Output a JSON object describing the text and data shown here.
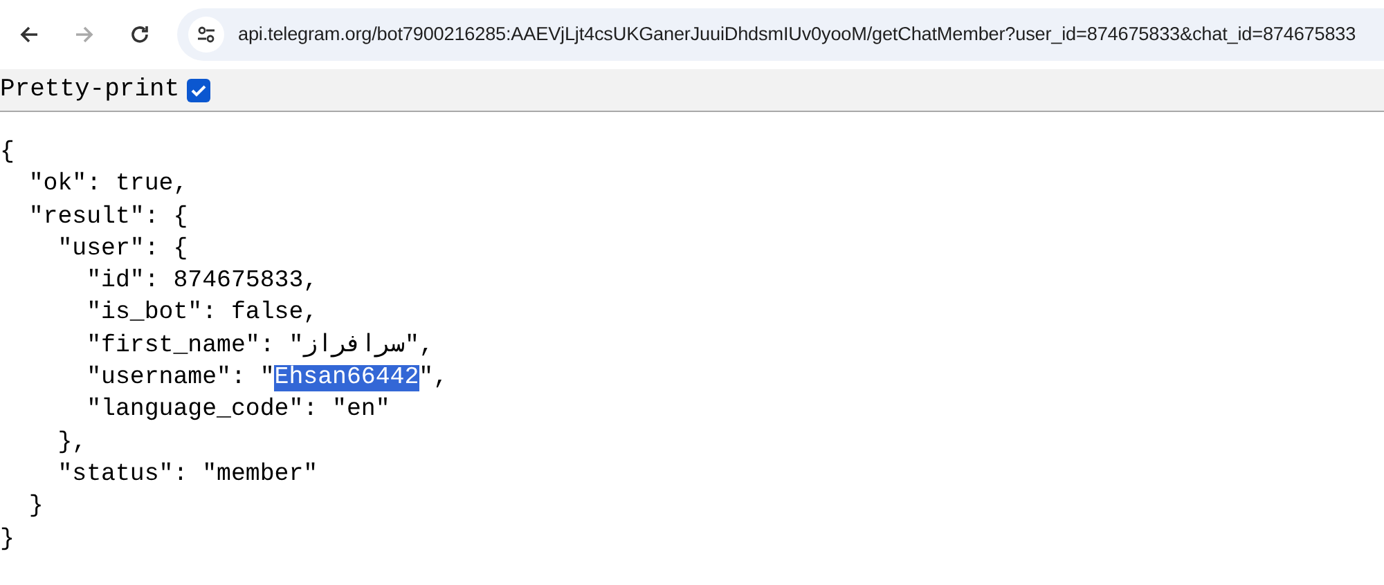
{
  "toolbar": {
    "url": "api.telegram.org/bot7900216285:AAEVjLjt4csUKGanerJuuiDhdsmIUv0yooM/getChatMember?user_id=874675833&chat_id=874675833",
    "forward_disabled": true
  },
  "pretty_print": {
    "label": "Pretty-print",
    "checked": true
  },
  "json_lines": [
    [
      {
        "text": "{",
        "selected": false
      }
    ],
    [
      {
        "text": "  \"ok\": true,",
        "selected": false
      }
    ],
    [
      {
        "text": "  \"result\": {",
        "selected": false
      }
    ],
    [
      {
        "text": "    \"user\": {",
        "selected": false
      }
    ],
    [
      {
        "text": "      \"id\": 874675833,",
        "selected": false
      }
    ],
    [
      {
        "text": "      \"is_bot\": false,",
        "selected": false
      }
    ],
    [
      {
        "text": "      \"first_name\": \"سرافراز\",",
        "selected": false
      }
    ],
    [
      {
        "text": "      \"username\": \"",
        "selected": false
      },
      {
        "text": "Ehsan66442",
        "selected": true
      },
      {
        "text": "\",",
        "selected": false
      }
    ],
    [
      {
        "text": "      \"language_code\": \"en\"",
        "selected": false
      }
    ],
    [
      {
        "text": "    },",
        "selected": false
      }
    ],
    [
      {
        "text": "    \"status\": \"member\"",
        "selected": false
      }
    ],
    [
      {
        "text": "  }",
        "selected": false
      }
    ],
    [
      {
        "text": "}",
        "selected": false
      }
    ]
  ]
}
